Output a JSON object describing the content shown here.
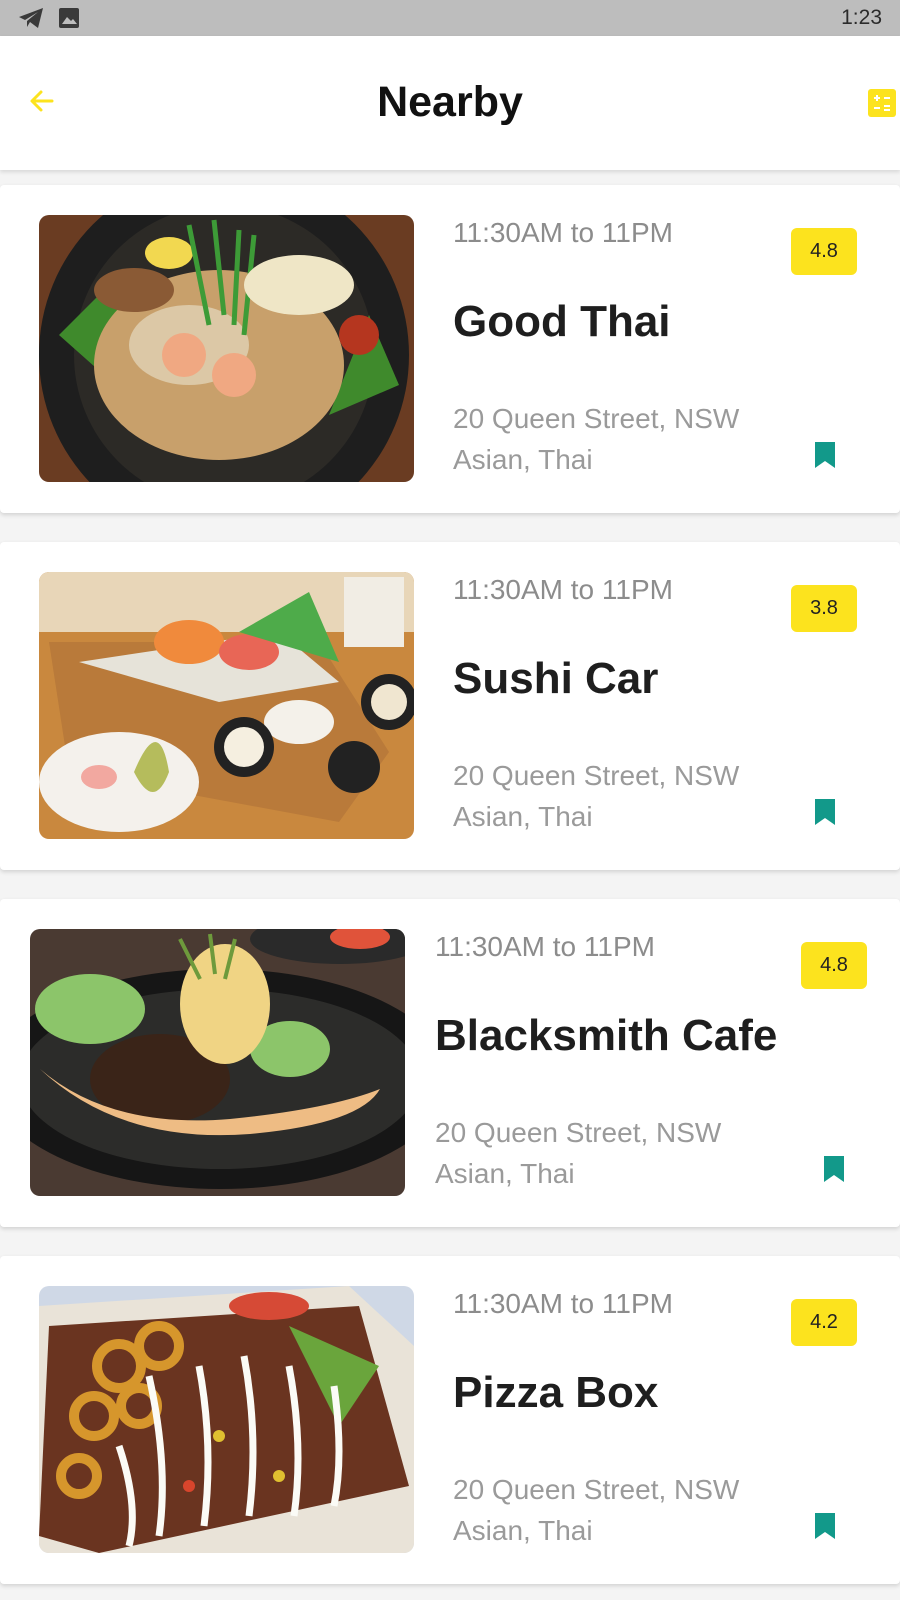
{
  "status_bar": {
    "time": "1:23",
    "icons": [
      "telegram-icon",
      "image-icon"
    ]
  },
  "app_bar": {
    "title": "Nearby",
    "back_icon": "arrow-left-icon",
    "action_icon": "calculator-icon",
    "accent": "#fce31e"
  },
  "restaurants": [
    {
      "hours": "11:30AM to 11PM",
      "name": "Good Thai",
      "rating": "4.8",
      "address": "20 Queen Street, NSW",
      "cuisine": "Asian, Thai"
    },
    {
      "hours": "11:30AM to 11PM",
      "name": "Sushi Car",
      "rating": "3.8",
      "address": "20 Queen Street, NSW",
      "cuisine": "Asian, Thai"
    },
    {
      "hours": "11:30AM to 11PM",
      "name": "Blacksmith Cafe",
      "rating": "4.8",
      "address": "20 Queen Street, NSW",
      "cuisine": "Asian, Thai"
    },
    {
      "hours": "11:30AM to 11PM",
      "name": "Pizza Box",
      "rating": "4.2",
      "address": "20 Queen Street, NSW",
      "cuisine": "Asian, Thai"
    }
  ],
  "colors": {
    "rating_badge": "#fce31e",
    "bookmark": "#12998a"
  }
}
